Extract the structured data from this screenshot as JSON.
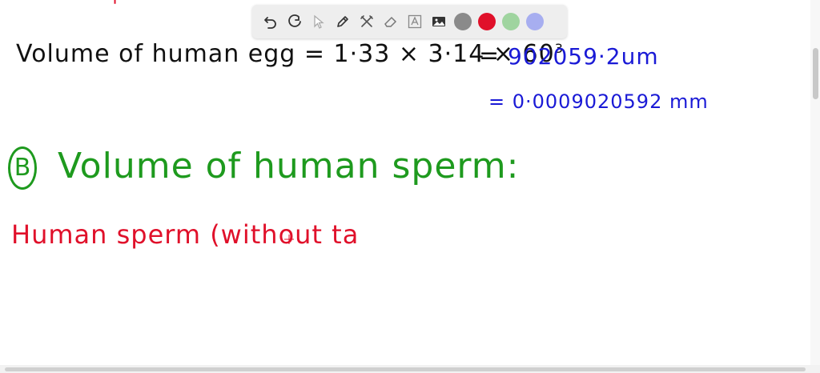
{
  "toolbar": {
    "tools": [
      "undo-icon",
      "redo-icon",
      "pointer-icon",
      "pen-icon",
      "tools-icon",
      "eraser-icon",
      "text-icon",
      "image-icon"
    ],
    "colors": [
      "#8a8a8a",
      "#e0102a",
      "#9fd49f",
      "#a7aef0"
    ]
  },
  "notes": {
    "line1": "Volume of human egg = 1·33 × 3·14 × 60",
    "line1_exp": "3",
    "eq1": "=",
    "result1": "902059·2um",
    "result2": "= 0·0009020592 mm",
    "b_label": "B",
    "line2": "Volume of human sperm:",
    "line3": "Human sperm (without ta"
  }
}
